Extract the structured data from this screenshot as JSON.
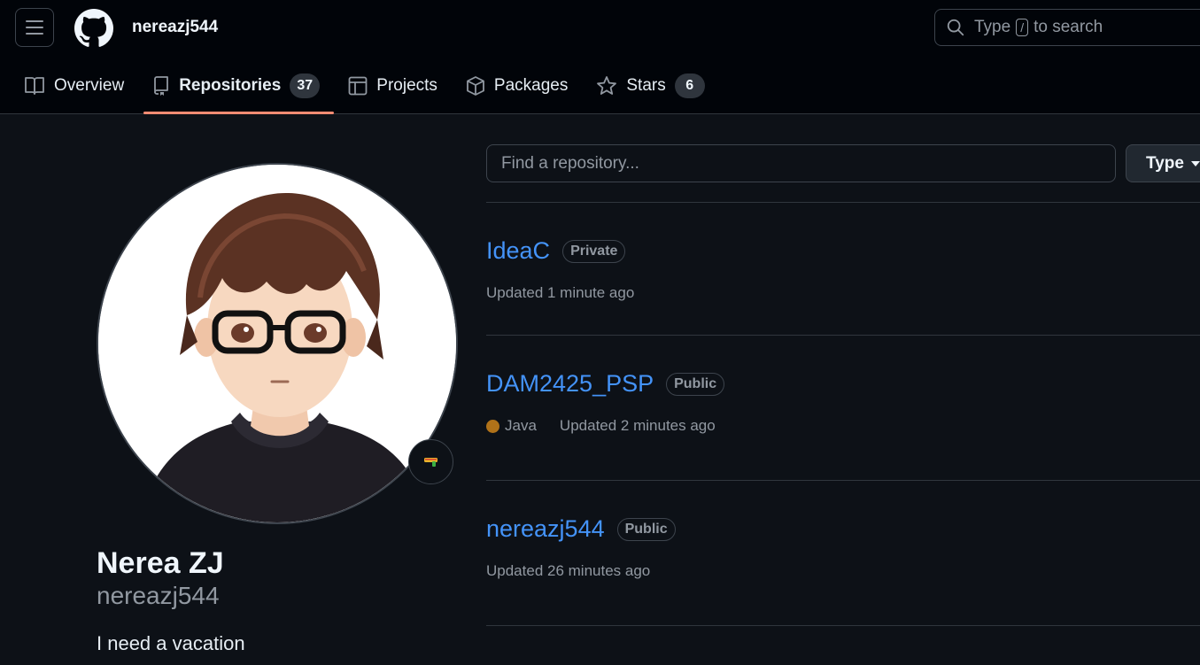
{
  "header": {
    "username": "nereazj544",
    "search": {
      "before": "Type",
      "key": "/",
      "after": "to search"
    }
  },
  "tabs": [
    {
      "label": "Overview",
      "icon": "book-icon"
    },
    {
      "label": "Repositories",
      "count": "37",
      "icon": "repo-icon",
      "active": true
    },
    {
      "label": "Projects",
      "icon": "table-icon"
    },
    {
      "label": "Packages",
      "icon": "package-icon"
    },
    {
      "label": "Stars",
      "count": "6",
      "icon": "star-icon"
    }
  ],
  "profile": {
    "full_name": "Nerea ZJ",
    "login": "nereazj544",
    "bio": "I need a vacation",
    "status_icon": "water-pistol-emoji"
  },
  "filter": {
    "placeholder": "Find a repository...",
    "type_label": "Type"
  },
  "repos": [
    {
      "name": "IdeaC",
      "visibility": "Private",
      "language": "",
      "updated": "Updated 1 minute ago"
    },
    {
      "name": "DAM2425_PSP",
      "visibility": "Public",
      "language": "Java",
      "language_color": "#b07219",
      "updated": "Updated 2 minutes ago"
    },
    {
      "name": "nereazj544",
      "visibility": "Public",
      "language": "",
      "updated": "Updated 26 minutes ago"
    }
  ],
  "colors": {
    "accent_link": "#4493f8",
    "tab_underline": "#fd8c73",
    "background": "#0d1117",
    "header_bg": "#010409"
  }
}
